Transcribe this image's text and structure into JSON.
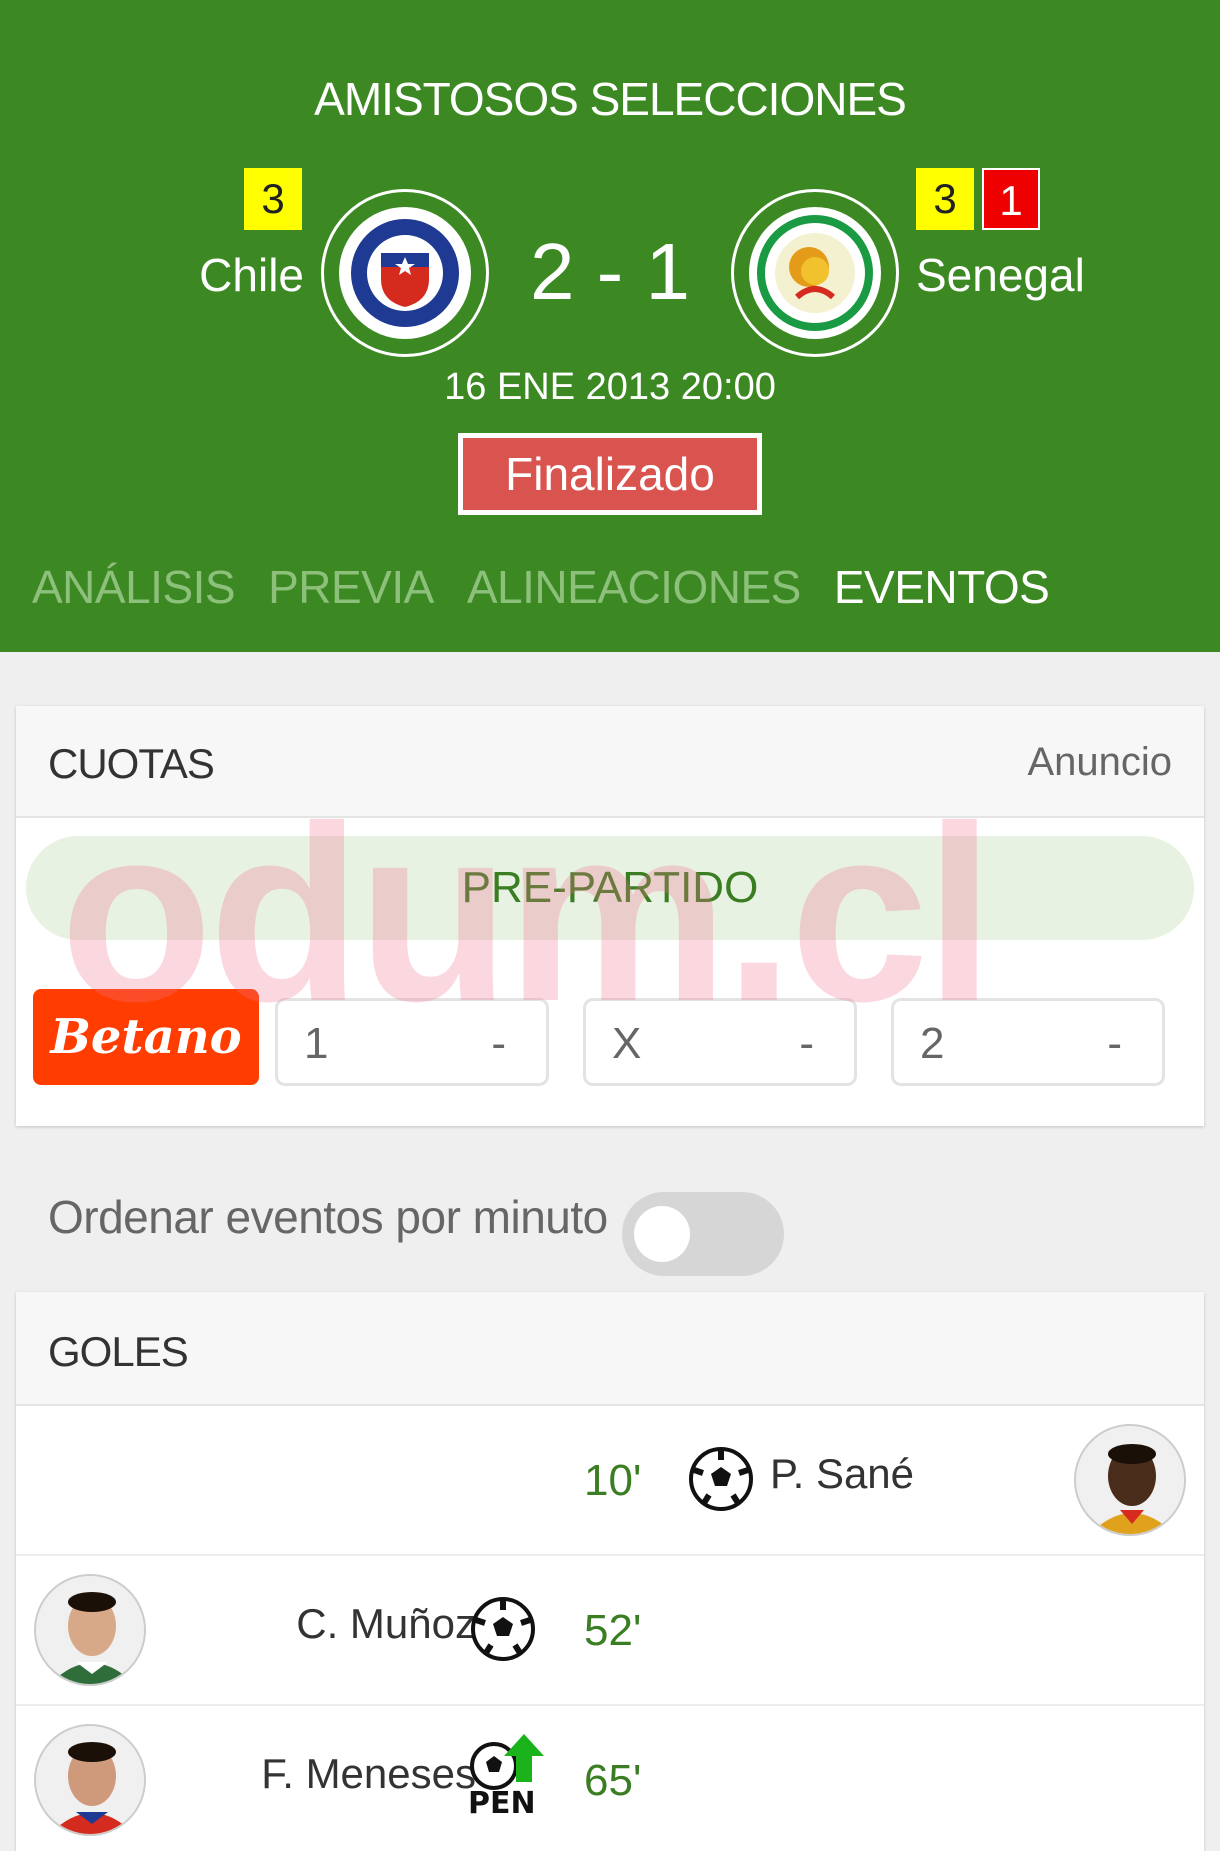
{
  "match": {
    "competition": "AMISTOSOS SELECCIONES",
    "home": {
      "name": "Chile",
      "yellow_cards": "3"
    },
    "away": {
      "name": "Senegal",
      "yellow_cards": "3",
      "red_cards": "1"
    },
    "score": "2 - 1",
    "datetime": "16 ENE 2013 20:00",
    "status": "Finalizado"
  },
  "tabs": [
    {
      "label": "ANÁLISIS",
      "active": false
    },
    {
      "label": "PREVIA",
      "active": false
    },
    {
      "label": "ALINEACIONES",
      "active": false
    },
    {
      "label": "EVENTOS",
      "active": true
    }
  ],
  "odds": {
    "title": "CUOTAS",
    "ad_label": "Anuncio",
    "section": "PRE-PARTIDO",
    "bookmaker": "Betano",
    "options": [
      {
        "label": "1",
        "value": "-"
      },
      {
        "label": "X",
        "value": "-"
      },
      {
        "label": "2",
        "value": "-"
      }
    ]
  },
  "sort": {
    "label": "Ordenar eventos por minuto",
    "enabled": false
  },
  "goals": {
    "title": "GOLES",
    "events": [
      {
        "minute": "10'",
        "player": "P. Sané",
        "side": "away",
        "type": "goal"
      },
      {
        "minute": "52'",
        "player": "C. Muñoz",
        "side": "home",
        "type": "goal"
      },
      {
        "minute": "65'",
        "player": "F. Meneses",
        "side": "home",
        "type": "penalty",
        "penalty_label": "PEN"
      }
    ]
  },
  "watermark": "odum.cl",
  "colors": {
    "header": "#3c8923",
    "status": "#d9534f",
    "minute": "#3a7d22",
    "betano": "#ff3d00"
  }
}
